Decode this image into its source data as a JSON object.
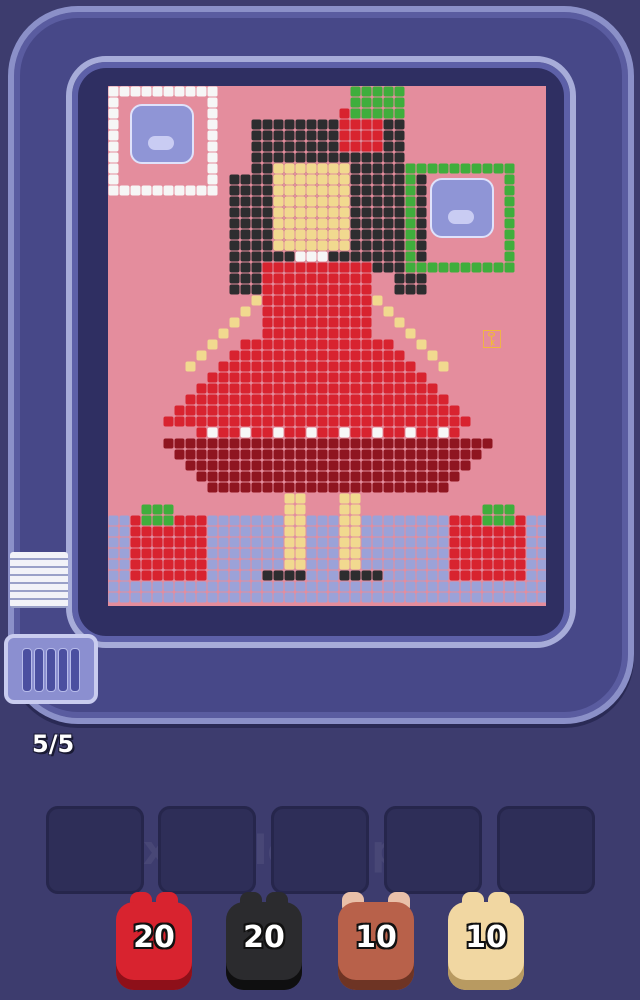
{
  "game": {
    "watermark_text": "Pixel-Flow.app",
    "ammo_counter": "5/5",
    "queue_slots": 5,
    "shooters": [
      {
        "color": "#d8232f",
        "dark": "#8e1019",
        "count": "20",
        "icon": "red-shooter-icon"
      },
      {
        "color": "#2b2b2e",
        "dark": "#0f0f10",
        "count": "20",
        "icon": "black-shooter-icon"
      },
      {
        "color": "#b8614a",
        "dark": "#6e3424",
        "count": "10",
        "icon": "bull-shooter-icon"
      },
      {
        "color": "#f1d7a2",
        "dark": "#b89a61",
        "count": "10",
        "icon": "cream-shooter-icon"
      }
    ],
    "colors": {
      "background": "#e48d9d",
      "hair": "#2d2d2f",
      "skin": "#f1d98f",
      "dress": "#d8232f",
      "dress_dark": "#8f1520",
      "leaf": "#3fae3c",
      "floor": "#9ba2d8",
      "white": "#f6f6f6"
    }
  }
}
